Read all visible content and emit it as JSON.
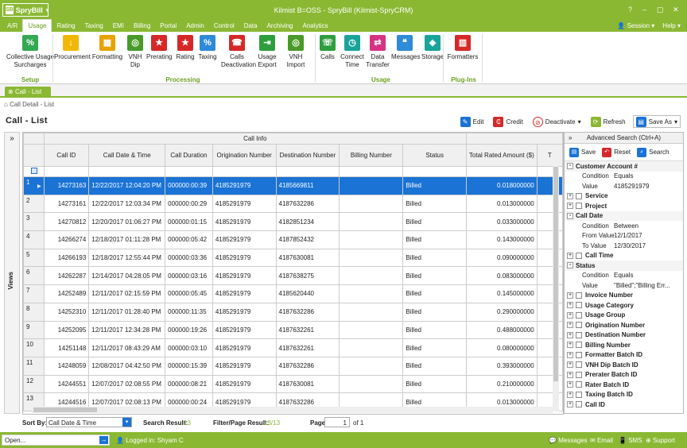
{
  "app": {
    "name": "SpryBill",
    "title": "Kilmist B=OSS - SpryBill (Kilmist-SpryCRM)",
    "accent": "#8ab833"
  },
  "window_controls": [
    "?",
    "–",
    "▢",
    "✕"
  ],
  "menu": {
    "tabs": [
      "A/R",
      "Usage",
      "Rating",
      "Taxing",
      "EMI",
      "Billing",
      "Portal",
      "Admin",
      "Control",
      "Data",
      "Archiving",
      "Analytics"
    ],
    "active": "Usage",
    "session": "Session",
    "help": "Help"
  },
  "ribbon": {
    "setup": {
      "label": "Setup",
      "buttons": [
        {
          "label": "Collective Usage\nSurcharges",
          "icon": "tag-icon"
        }
      ]
    },
    "processing": {
      "label": "Processing",
      "buttons": [
        {
          "label": "Procurement",
          "icon": "download-icon"
        },
        {
          "label": "Formatting",
          "icon": "format-icon"
        },
        {
          "label": "VNH\nDip",
          "icon": "globe-icon"
        },
        {
          "label": "Prerating",
          "icon": "star-icon"
        },
        {
          "label": "Rating",
          "icon": "star-icon"
        },
        {
          "label": "Taxing",
          "icon": "percent-icon"
        },
        {
          "label": "Calls\nDeactivation",
          "icon": "phone-off-icon"
        },
        {
          "label": "Usage\nExport",
          "icon": "export-icon"
        },
        {
          "label": "VNH Import",
          "icon": "globe-icon"
        }
      ]
    },
    "usage": {
      "label": "Usage",
      "buttons": [
        {
          "label": "Calls",
          "icon": "phone-icon"
        },
        {
          "label": "Connect\nTime",
          "icon": "clock-icon"
        },
        {
          "label": "Data\nTransfer",
          "icon": "transfer-icon"
        },
        {
          "label": "Messages",
          "icon": "chat-icon"
        },
        {
          "label": "Storage",
          "icon": "cube-icon"
        }
      ]
    },
    "plugins": {
      "label": "Plug-Ins",
      "buttons": [
        {
          "label": "Formatters",
          "icon": "formatter-icon"
        }
      ]
    }
  },
  "doc_tab": "Call - List",
  "breadcrumb": "Call Detail - List",
  "list_title": "Call - List",
  "toolbar": {
    "edit": "Edit",
    "credit": "Credit",
    "deactivate": "Deactivate",
    "refresh": "Refresh",
    "save_as": "Save As"
  },
  "views_label": "Views",
  "grid": {
    "group_header": "Call Info",
    "columns": [
      "Call ID",
      "Call Date & Time",
      "Call Duration",
      "Origination Number",
      "Destination Number",
      "Billing Number",
      "Status",
      "Total Rated Amount ($)",
      "T"
    ],
    "rows": [
      [
        "1",
        "14273163",
        "12/22/2017 12:04:20 PM",
        "000000:00:39",
        "4185291979",
        "4185669811",
        "",
        "Billed",
        "0.018000000"
      ],
      [
        "2",
        "14273161",
        "12/22/2017 12:03:34 PM",
        "000000:00:29",
        "4185291979",
        "4187632286",
        "",
        "Billed",
        "0.013000000"
      ],
      [
        "3",
        "14270812",
        "12/20/2017 01:06:27 PM",
        "000000:01:15",
        "4185291979",
        "4182851234",
        "",
        "Billed",
        "0.033000000"
      ],
      [
        "4",
        "14266274",
        "12/18/2017 01:11:28 PM",
        "000000:05:42",
        "4185291979",
        "4187852432",
        "",
        "Billed",
        "0.143000000"
      ],
      [
        "5",
        "14266193",
        "12/18/2017 12:55:44 PM",
        "000000:03:36",
        "4185291979",
        "4187630081",
        "",
        "Billed",
        "0.090000000"
      ],
      [
        "6",
        "14262287",
        "12/14/2017 04:28:05 PM",
        "000000:03:16",
        "4185291979",
        "4187638275",
        "",
        "Billed",
        "0.083000000"
      ],
      [
        "7",
        "14252489",
        "12/11/2017 02:15:59 PM",
        "000000:05:45",
        "4185291979",
        "4185620440",
        "",
        "Billed",
        "0.145000000"
      ],
      [
        "8",
        "14252310",
        "12/11/2017 01:28:40 PM",
        "000000:11:35",
        "4185291979",
        "4187632286",
        "",
        "Billed",
        "0.290000000"
      ],
      [
        "9",
        "14252095",
        "12/11/2017 12:34:28 PM",
        "000000:19:26",
        "4185291979",
        "4187632261",
        "",
        "Billed",
        "0.488000000"
      ],
      [
        "10",
        "14251148",
        "12/11/2017 08:43:29 AM",
        "000000:03:10",
        "4185291979",
        "4187632261",
        "",
        "Billed",
        "0.080000000"
      ],
      [
        "11",
        "14248059",
        "12/08/2017 04:42:50 PM",
        "000000:15:39",
        "4185291979",
        "4187632286",
        "",
        "Billed",
        "0.393000000"
      ],
      [
        "12",
        "14244551",
        "12/07/2017 02:08:55 PM",
        "000000:08:21",
        "4185291979",
        "4187630081",
        "",
        "Billed",
        "0.210000000"
      ],
      [
        "13",
        "14244516",
        "12/07/2017 02:08:13 PM",
        "000000:00:24",
        "4185291979",
        "4187632286",
        "",
        "Billed",
        "0.013000000"
      ]
    ]
  },
  "advanced": {
    "title": "Advanced Search (Ctrl+A)",
    "save": "Save",
    "reset": "Reset",
    "search": "Search",
    "items": [
      {
        "kind": "group",
        "label": "Customer Account #",
        "exp": "-"
      },
      {
        "kind": "sub",
        "k": "Condition",
        "v": "Equals"
      },
      {
        "kind": "sub",
        "k": "Value",
        "v": "4185291979"
      },
      {
        "kind": "check",
        "label": "Service",
        "exp": "+"
      },
      {
        "kind": "check",
        "label": "Project",
        "exp": "+"
      },
      {
        "kind": "group",
        "label": "Call Date",
        "exp": "-"
      },
      {
        "kind": "sub",
        "k": "Condition",
        "v": "Between"
      },
      {
        "kind": "sub",
        "k": "From Value",
        "v": "12/1/2017"
      },
      {
        "kind": "sub",
        "k": "To Value",
        "v": "12/30/2017"
      },
      {
        "kind": "check",
        "label": "Call Time",
        "exp": "+"
      },
      {
        "kind": "group",
        "label": "Status",
        "exp": "-"
      },
      {
        "kind": "sub",
        "k": "Condition",
        "v": "Equals"
      },
      {
        "kind": "sub",
        "k": "Value",
        "v": "\"Billed\";\"Billing Err..."
      },
      {
        "kind": "check",
        "label": "Invoice Number",
        "exp": "+"
      },
      {
        "kind": "check",
        "label": "Usage Category",
        "exp": "+"
      },
      {
        "kind": "check",
        "label": "Usage Group",
        "exp": "+"
      },
      {
        "kind": "check",
        "label": "Origination Number",
        "exp": "+"
      },
      {
        "kind": "check",
        "label": "Destination Number",
        "exp": "+"
      },
      {
        "kind": "check",
        "label": "Billing Number",
        "exp": "+"
      },
      {
        "kind": "check",
        "label": "Formatter Batch ID",
        "exp": "+"
      },
      {
        "kind": "check",
        "label": "VNH Dip Batch ID",
        "exp": "+"
      },
      {
        "kind": "check",
        "label": "Prerater Batch ID",
        "exp": "+"
      },
      {
        "kind": "check",
        "label": "Rater Batch ID",
        "exp": "+"
      },
      {
        "kind": "check",
        "label": "Taxing Batch ID",
        "exp": "+"
      },
      {
        "kind": "check",
        "label": "Call ID",
        "exp": "+"
      }
    ]
  },
  "sortbar": {
    "sort_label": "Sort By:",
    "sort_value": "Call Date & Time",
    "search_result_label": "Search Result:",
    "search_result": "13",
    "filter_label": "Filter/Page Result:",
    "filter_value": "13/13",
    "page_label": "Page",
    "page_value": "1",
    "page_of": "of 1"
  },
  "status": {
    "open": "Open...",
    "logged_in": "Logged in: Shyam C",
    "messages": "Messages",
    "email": "Email",
    "sms": "SMS",
    "support": "Support"
  }
}
